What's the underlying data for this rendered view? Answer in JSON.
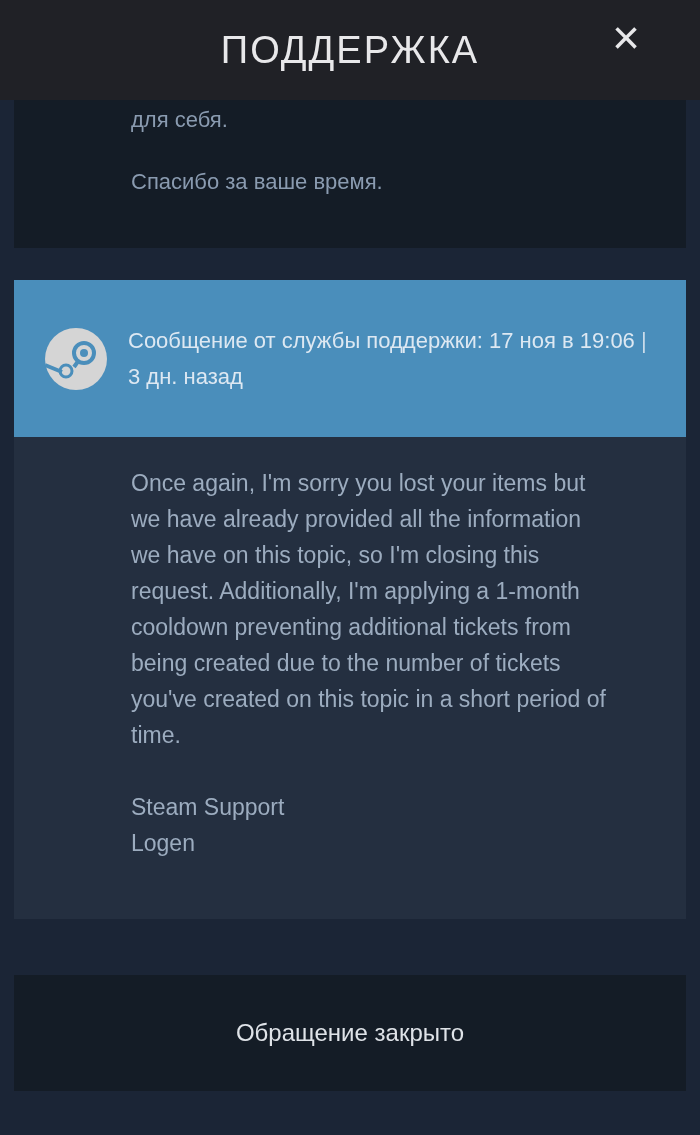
{
  "header": {
    "title": "ПОДДЕРЖКА",
    "close": "×"
  },
  "previous_message": {
    "paragraphs": [
      "для себя.",
      "Спасибо за ваше время."
    ]
  },
  "support_message": {
    "meta_line": "Сообщение от службы поддержки: 17 ноя в 19:06",
    "separator": "|",
    "ago": "3 дн. назад",
    "body": "Once again, I'm sorry you lost your items but we have already provided all the information we have on this topic, so I'm closing this request. Additionally, I'm applying a 1-month cooldown preventing additional tickets from being created due to the number of tickets you've created on this topic in a short period of time.",
    "signature": [
      "Steam Support",
      "Logen"
    ]
  },
  "status": "Обращение закрыто"
}
